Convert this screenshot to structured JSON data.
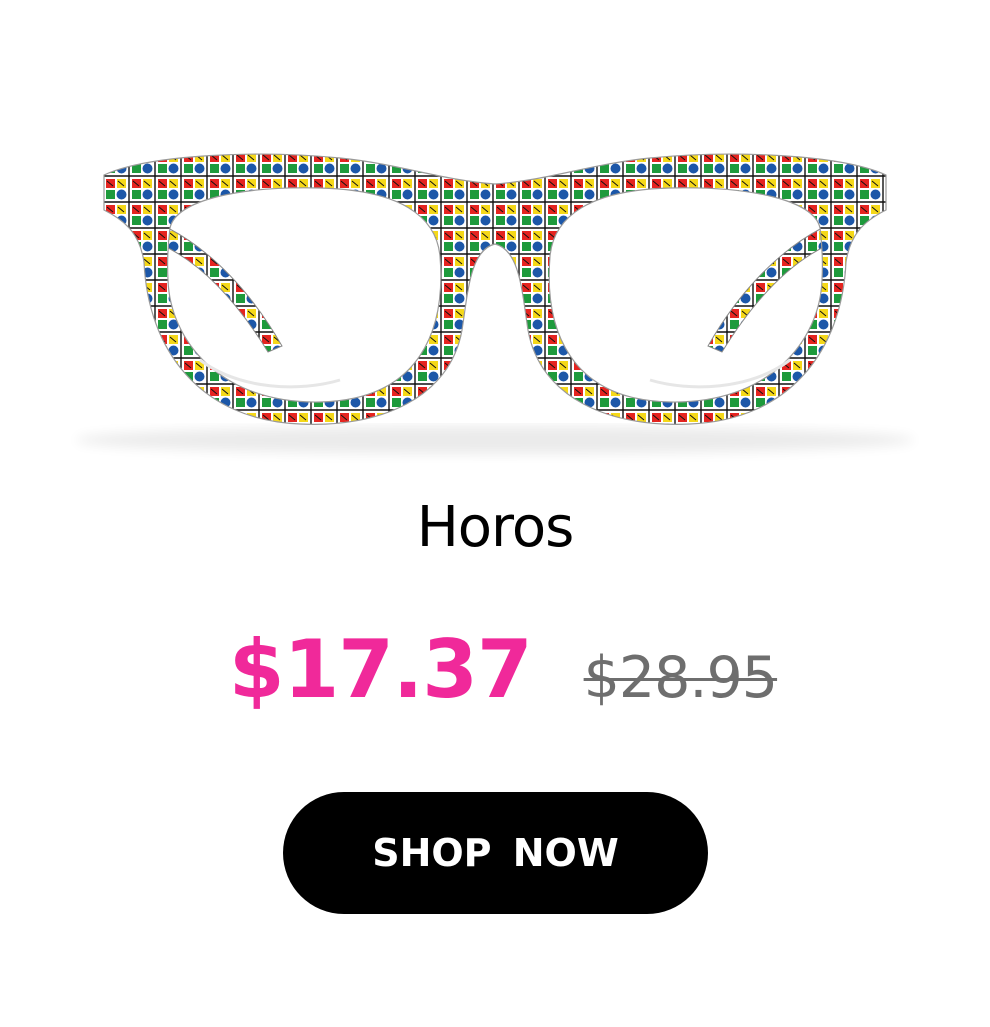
{
  "product": {
    "name": "Horos",
    "image_alt": "Horos glasses frame with zodiac pattern",
    "price_sale": "$17.37",
    "price_regular": "$28.95"
  },
  "cta": {
    "label": "SHOP NOW"
  },
  "colors": {
    "sale_price": "#f0299a",
    "regular_price": "#6e6e6e",
    "button_bg": "#000000",
    "button_text": "#ffffff",
    "pattern": [
      "#e52420",
      "#1c57a8",
      "#f5d819",
      "#1e9a3c",
      "#ffffff"
    ]
  }
}
